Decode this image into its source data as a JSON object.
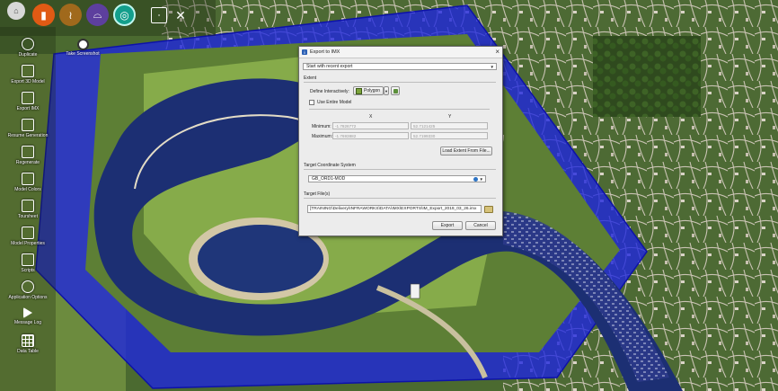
{
  "colors": {
    "accent": "#1f2bd8",
    "boundary_fill": "#1d25e0",
    "water": "#1c2f73",
    "grass": "#6e9a3c",
    "dialog_bg": "#ececec"
  },
  "topbar": {
    "buttons": [
      {
        "icon": "home-icon",
        "color": "#d8d8d8"
      },
      {
        "icon": "pin-icon",
        "color": "#e05a14"
      },
      {
        "icon": "road-icon",
        "color": "#a0691c"
      },
      {
        "icon": "bridge-icon",
        "color": "#5d3f9e"
      },
      {
        "icon": "settings-icon",
        "color": "#139f8c"
      },
      {
        "icon": "select-box-icon",
        "color": "none"
      },
      {
        "icon": "move-cross-icon",
        "color": "none"
      }
    ]
  },
  "map_label": "Take Screenshot",
  "sidebar": {
    "items": [
      {
        "label": "Duplicate",
        "icon": "duplicate-icon"
      },
      {
        "label": "Export 3D Model",
        "icon": "export-3d-model-icon"
      },
      {
        "label": "Export IMX",
        "icon": "export-imx-icon"
      },
      {
        "label": "Resume Generation",
        "icon": "resume-generation-icon"
      },
      {
        "label": "Regenerate",
        "icon": "regenerate-icon"
      },
      {
        "label": "Model Colors",
        "icon": "model-colors-icon"
      },
      {
        "label": "Toursheet",
        "icon": "toursheet-icon"
      },
      {
        "label": "Model Properties",
        "icon": "model-properties-icon"
      },
      {
        "label": "Scripts",
        "icon": "scripts-icon"
      },
      {
        "label": "Application Options",
        "icon": "application-options-icon"
      },
      {
        "label": "Message Log",
        "icon": "message-log-icon"
      },
      {
        "label": "Data Table",
        "icon": "data-table-icon"
      }
    ]
  },
  "dialog": {
    "title": "Export to IMX",
    "recent_export": "Start with recent export",
    "extent_section": "Extent",
    "define_interactively_label": "Define Interactively:",
    "polygon_button": "Polygon",
    "use_entire_model_label": "Use Entire Model",
    "x_header": "X",
    "y_header": "Y",
    "minimum_label": "Minimum:",
    "maximum_label": "Maximum:",
    "min_x": "-1.7826772",
    "min_y": "52.7121425",
    "max_x": "-1.7693882",
    "max_y": "52.7199330",
    "load_extent_button": "Load Extent From File...",
    "target_coord_section": "Target Coordinate System",
    "coord_system_value": "GB_ORD1-MOD",
    "target_files_section": "Target File(s)",
    "target_file_path": "[TRAINING\\Delivery\\INFRAWORKS\\DATA\\IMX\\EXPORTS\\IM_Export_2019_03_26.imx",
    "export_button": "Export",
    "cancel_button": "Cancel"
  }
}
